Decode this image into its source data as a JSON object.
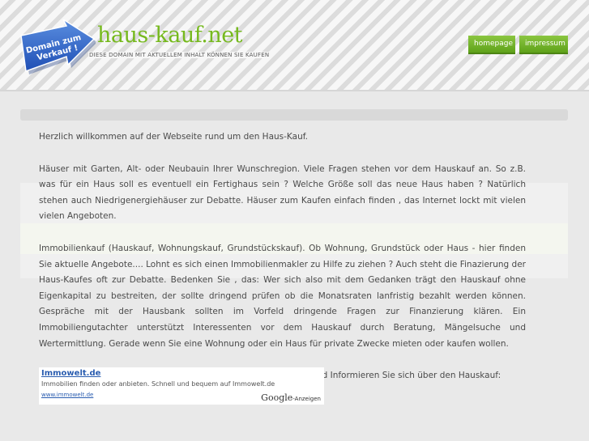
{
  "header": {
    "logo_text_line1": "Domain zum",
    "logo_text_line2": "Verkauf !",
    "site_title": "haus-kauf.net",
    "tagline": "DIESE DOMAIN MIT AKTUELLEM INHALT KÖNNEN SIE KAUFEN",
    "nav": [
      {
        "label": "homepage"
      },
      {
        "label": "impressum"
      }
    ]
  },
  "content": {
    "paragraphs": [
      "Herzlich willkommen auf der Webseite rund um den Haus-Kauf.",
      "Häuser mit Garten, Alt- oder Neubauin Ihrer Wunschregion. Viele Fragen stehen vor dem Hauskauf an. So z.B. was für ein Haus soll es eventuell ein Fertighaus sein ? Welche Größe soll das neue Haus haben ? Natürlich stehen auch Niedrigenergiehäuser zur Debatte. Häuser zum Kaufen einfach finden , das Internet lockt mit vielen vielen Angeboten.",
      "Immobilienkauf (Hauskauf, Wohnungskauf, Grundstückskauf). Ob Wohnung, Grundstück oder Haus - hier finden Sie aktuelle Angebote.... Lohnt es sich einen Immobilienmakler zu Hilfe zu ziehen ? Auch steht die Finazierung der Haus-Kaufes oft zur Debatte. Bedenken Sie , das: Wer sich also mit dem Gedanken trägt den Hauskauf ohne Eigenkapital zu bestreiten, der sollte dringend prüfen ob die Monatsraten lanfristig bezahlt werden können. Gespräche mit der Hausbank sollten im Vorfeld dringende Fragen zur Finanzierung klären. Ein Immobiliengutachter unterstützt Interessenten vor dem Hauskauf durch Beratung, Mängelsuche und Wertermittlung. Gerade wenn Sie eine Wohnung oder ein Haus für private Zwecke mieten oder kaufen wollen.",
      "Schauen Sie sich einfach mal bei den folgenden Angeboten um und Informieren Sie sich über den Hauskauf:"
    ]
  },
  "ad": {
    "title": "Immowelt.de",
    "text": "Immobilien finden oder anbieten. Schnell und bequem auf Immowelt.de",
    "url": "www.immowelt.de",
    "google": "Google",
    "label": "-Anzeigen"
  }
}
